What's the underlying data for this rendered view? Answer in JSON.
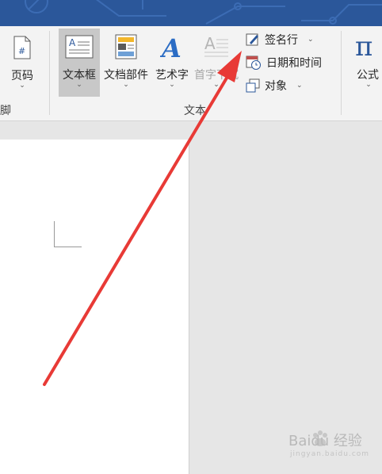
{
  "ribbon": {
    "page_number_label": "页码",
    "textbox_label": "文本框",
    "quickparts_label": "文档部件",
    "wordart_label": "艺术字",
    "dropcap_label": "首字下沉",
    "signature_label": "签名行",
    "datetime_label": "日期和时间",
    "object_label": "对象",
    "equation_label": "公式",
    "left_group_partial_label": "脚",
    "text_group_label": "文本"
  },
  "watermark": {
    "text": "Baidu 经验",
    "sub": "jingyan.baidu.com"
  },
  "colors": {
    "titlebar": "#2b579a",
    "arrow": "#e83a36",
    "ribbon_bg": "#f3f3f3",
    "active_button": "#c8c8c8"
  },
  "icons": [
    "page-number-icon",
    "textbox-icon",
    "quickparts-icon",
    "wordart-icon",
    "dropcap-icon",
    "signature-line-icon",
    "calendar-clock-icon",
    "object-icon",
    "pi-icon",
    "arrow-annotation",
    "baidu-paw-icon"
  ]
}
